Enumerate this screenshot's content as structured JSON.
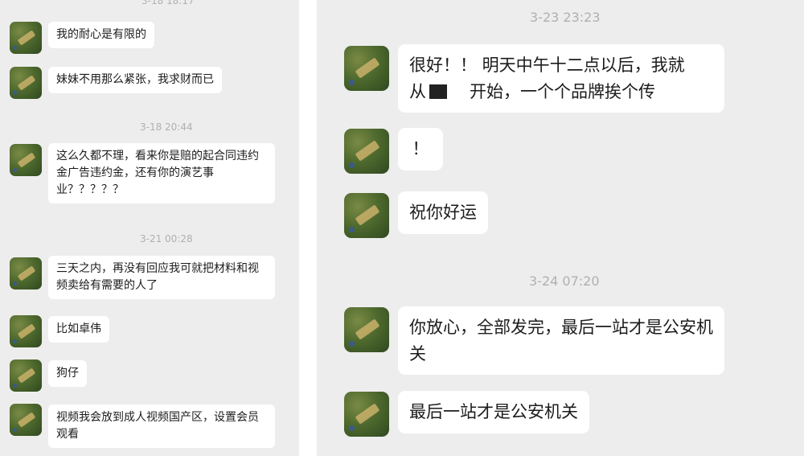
{
  "left": {
    "timestamp_top": "3-18 18:17",
    "messages": [
      {
        "text": "我的耐心是有限的"
      },
      {
        "text": "妹妹不用那么紧张，我求财而已"
      },
      {
        "text": "这么久都不理，看来你是赔的起合同违约金广告违约金，还有你的演艺事业？？？？？"
      },
      {
        "text": "三天之内，再没有回应我可就把材料和视频卖给有需要的人了"
      },
      {
        "text": "比如卓伟"
      },
      {
        "text": "狗仔"
      },
      {
        "text": "视频我会放到成人视频国产区，设置会员观看"
      }
    ],
    "timestamps": [
      "3-18 20:44",
      "3-21 00:28"
    ]
  },
  "right": {
    "timestamps": [
      "3-23 23:23",
      "3-24 07:20"
    ],
    "messages": [
      {
        "line1": "很好！！ 明天中午十二点以后，我就",
        "line2a": "从",
        "line2b": "开始，一个个品牌挨个传"
      },
      {
        "text": "！"
      },
      {
        "text": "祝你好运"
      },
      {
        "text": "你放心，全部发完，最后一站才是公安机关"
      },
      {
        "text": "最后一站才是公安机关"
      }
    ]
  }
}
